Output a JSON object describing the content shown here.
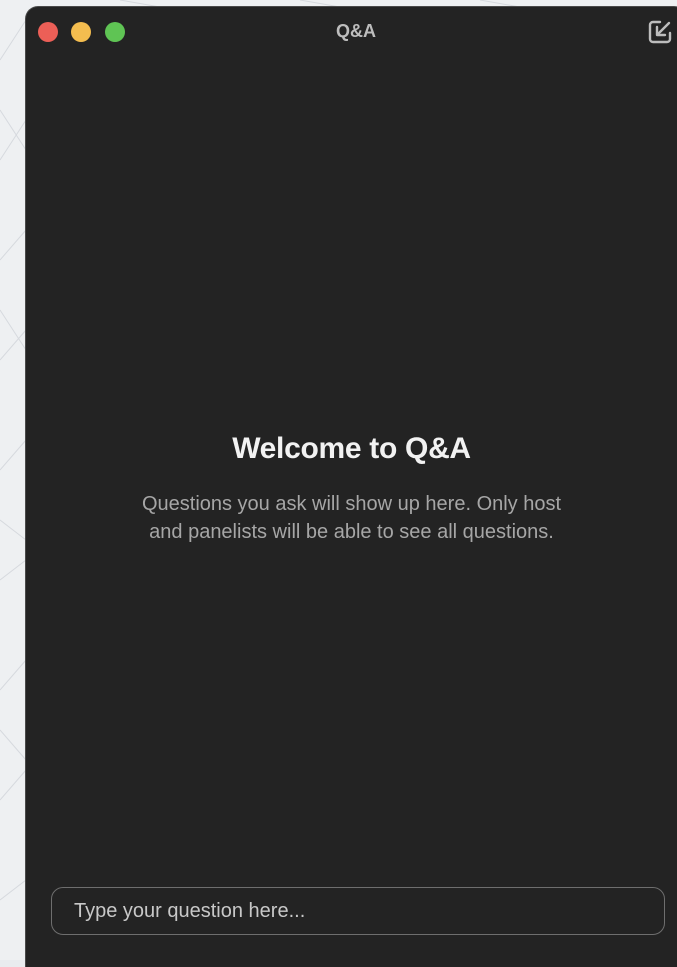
{
  "window": {
    "title": "Q&A"
  },
  "titlebar": {
    "buttons": [
      {
        "name": "close",
        "color": "#ec5f57"
      },
      {
        "name": "minimize",
        "color": "#f4bd4f"
      },
      {
        "name": "maximize",
        "color": "#5fc454"
      }
    ],
    "popin_icon": "pop-in-arrow-icon"
  },
  "welcome": {
    "title": "Welcome to Q&A",
    "subtitle": "Questions you ask will show up here. Only host and panelists will be able to see all questions."
  },
  "question_input": {
    "placeholder": "Type your question here...",
    "value": ""
  },
  "colors": {
    "window_bg": "#232323",
    "title_text": "#bdbdbd",
    "heading_text": "#f2f2f2",
    "subtitle_text": "#a6a6a6",
    "input_border": "#6e6e6e"
  }
}
